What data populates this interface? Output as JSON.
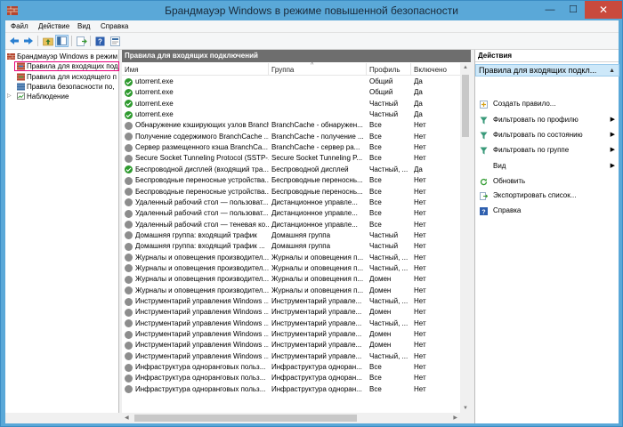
{
  "window": {
    "title": "Брандмауэр Windows в режиме повышенной безопасности",
    "min": "—",
    "max": "☐",
    "close": "✕"
  },
  "menu": [
    "Файл",
    "Действие",
    "Вид",
    "Справка"
  ],
  "tree": [
    {
      "label": "Брандмауэр Windows в режим",
      "icon": "firewall-icon"
    },
    {
      "label": "Правила для входящих под",
      "icon": "inbound-rules-icon",
      "selected": true
    },
    {
      "label": "Правила для исходящего п",
      "icon": "outbound-rules-icon"
    },
    {
      "label": "Правила безопасности по,",
      "icon": "security-rules-icon"
    },
    {
      "label": "Наблюдение",
      "icon": "monitoring-icon",
      "expander": "▷"
    }
  ],
  "center": {
    "header": "Правила для входящих подключений",
    "columns": [
      "Имя",
      "Группа",
      "Профиль",
      "Включено"
    ],
    "sort_glyph": "^",
    "rows": [
      {
        "enabled": true,
        "name": "utorrent.exe",
        "group": "",
        "profile": "Общий",
        "on": "Да"
      },
      {
        "enabled": true,
        "name": "utorrent.exe",
        "group": "",
        "profile": "Общий",
        "on": "Да"
      },
      {
        "enabled": true,
        "name": "utorrent.exe",
        "group": "",
        "profile": "Частный",
        "on": "Да"
      },
      {
        "enabled": true,
        "name": "utorrent.exe",
        "group": "",
        "profile": "Частный",
        "on": "Да"
      },
      {
        "enabled": false,
        "name": "Обнаружение кэширующих узлов Branch...",
        "group": "BranchCache - обнаружен...",
        "profile": "Все",
        "on": "Нет"
      },
      {
        "enabled": false,
        "name": "Получение содержимого BranchCache ...",
        "group": "BranchCache - получение ...",
        "profile": "Все",
        "on": "Нет"
      },
      {
        "enabled": false,
        "name": "Сервер размещенного кэша BranchCa...",
        "group": "BranchCache - сервер ра...",
        "profile": "Все",
        "on": "Нет"
      },
      {
        "enabled": false,
        "name": "Secure Socket Tunneling Protocol (SSTP-...",
        "group": "Secure Socket Tunneling P...",
        "profile": "Все",
        "on": "Нет"
      },
      {
        "enabled": true,
        "name": "Беспроводной дисплей (входящий тра...",
        "group": "Беспроводной дисплей",
        "profile": "Частный, ...",
        "on": "Да"
      },
      {
        "enabled": false,
        "name": "Беспроводные переносные устройства...",
        "group": "Беспроводные переноснь...",
        "profile": "Все",
        "on": "Нет"
      },
      {
        "enabled": false,
        "name": "Беспроводные переносные устройства...",
        "group": "Беспроводные переноснь...",
        "profile": "Все",
        "on": "Нет"
      },
      {
        "enabled": false,
        "name": "Удаленный рабочий стол — пользоват...",
        "group": "Дистанционное управле...",
        "profile": "Все",
        "on": "Нет"
      },
      {
        "enabled": false,
        "name": "Удаленный рабочий стол — пользоват...",
        "group": "Дистанционное управле...",
        "profile": "Все",
        "on": "Нет"
      },
      {
        "enabled": false,
        "name": "Удаленный рабочий стол — теневая ко...",
        "group": "Дистанционное управле...",
        "profile": "Все",
        "on": "Нет"
      },
      {
        "enabled": false,
        "name": "Домашняя группа: входящий трафик",
        "group": "Домашняя группа",
        "profile": "Частный",
        "on": "Нет"
      },
      {
        "enabled": false,
        "name": "Домашняя группа: входящий трафик ...",
        "group": "Домашняя группа",
        "profile": "Частный",
        "on": "Нет"
      },
      {
        "enabled": false,
        "name": "Журналы и оповещения производител...",
        "group": "Журналы и оповещения п...",
        "profile": "Частный, ...",
        "on": "Нет"
      },
      {
        "enabled": false,
        "name": "Журналы и оповещения производител...",
        "group": "Журналы и оповещения п...",
        "profile": "Частный, ...",
        "on": "Нет"
      },
      {
        "enabled": false,
        "name": "Журналы и оповещения производител...",
        "group": "Журналы и оповещения п...",
        "profile": "Домен",
        "on": "Нет"
      },
      {
        "enabled": false,
        "name": "Журналы и оповещения производител...",
        "group": "Журналы и оповещения п...",
        "profile": "Домен",
        "on": "Нет"
      },
      {
        "enabled": false,
        "name": "Инструментарий управления Windows ...",
        "group": "Инструментарий управле...",
        "profile": "Частный, ...",
        "on": "Нет"
      },
      {
        "enabled": false,
        "name": "Инструментарий управления Windows ...",
        "group": "Инструментарий управле...",
        "profile": "Домен",
        "on": "Нет"
      },
      {
        "enabled": false,
        "name": "Инструментарий управления Windows ...",
        "group": "Инструментарий управле...",
        "profile": "Частный, ...",
        "on": "Нет"
      },
      {
        "enabled": false,
        "name": "Инструментарий управления Windows ...",
        "group": "Инструментарий управле...",
        "profile": "Домен",
        "on": "Нет"
      },
      {
        "enabled": false,
        "name": "Инструментарий управления Windows ...",
        "group": "Инструментарий управле...",
        "profile": "Домен",
        "on": "Нет"
      },
      {
        "enabled": false,
        "name": "Инструментарий управления Windows ...",
        "group": "Инструментарий управле...",
        "profile": "Частный, ...",
        "on": "Нет"
      },
      {
        "enabled": false,
        "name": "Инфраструктура одноранговых польз...",
        "group": "Инфраструктура одноран...",
        "profile": "Все",
        "on": "Нет"
      },
      {
        "enabled": false,
        "name": "Инфраструктура одноранговых польз...",
        "group": "Инфраструктура одноран...",
        "profile": "Все",
        "on": "Нет"
      },
      {
        "enabled": false,
        "name": "Инфраструктура одноранговых польз...",
        "group": "Инфраструктура одноран...",
        "profile": "Все",
        "on": "Нет"
      }
    ]
  },
  "actions": {
    "header": "Действия",
    "subheader": "Правила для входящих подкл...",
    "collapse": "▲",
    "items": [
      {
        "label": "Создать правило...",
        "icon": "new-rule-icon",
        "arrow": ""
      },
      {
        "label": "Фильтровать по профилю",
        "icon": "filter-icon",
        "arrow": "▶"
      },
      {
        "label": "Фильтровать по состоянию",
        "icon": "filter-icon",
        "arrow": "▶"
      },
      {
        "label": "Фильтровать по группе",
        "icon": "filter-icon",
        "arrow": "▶"
      },
      {
        "label": "Вид",
        "icon": "",
        "arrow": "▶"
      },
      {
        "label": "Обновить",
        "icon": "refresh-icon",
        "arrow": ""
      },
      {
        "label": "Экспортировать список...",
        "icon": "export-icon",
        "arrow": ""
      },
      {
        "label": "Справка",
        "icon": "help-icon",
        "arrow": ""
      }
    ]
  },
  "colors": {
    "titlebar": "#5aa8d8",
    "close": "#c94a3d",
    "selection": "#e8007a",
    "enabled": "#2e9a2e",
    "disabled": "#8d8d8d"
  }
}
